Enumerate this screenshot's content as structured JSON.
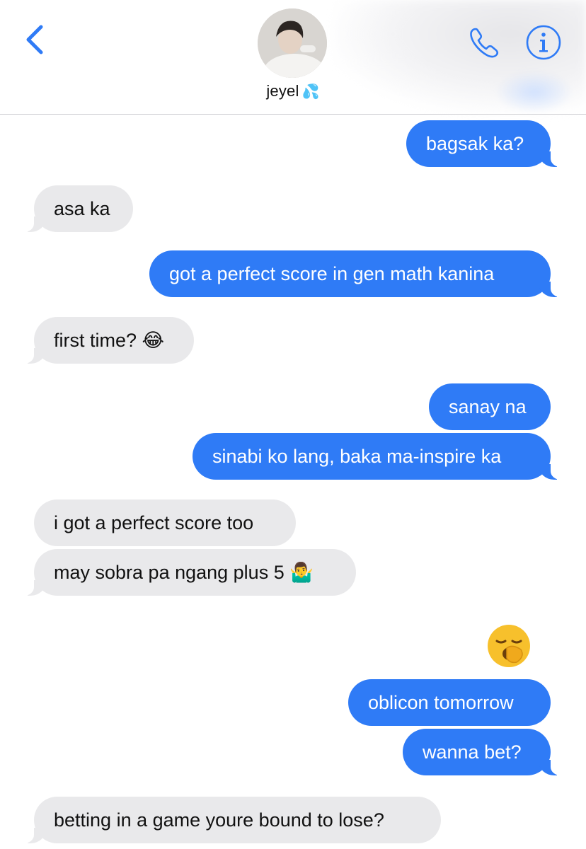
{
  "header": {
    "contact_name": "jeyel",
    "contact_emoji": "💦",
    "icons": [
      "chevron-left-icon",
      "phone-icon",
      "info-icon"
    ],
    "accent_color": "#2f7bf6"
  },
  "messages": [
    {
      "id": "m1",
      "from": "me",
      "text": "bagsak ka?"
    },
    {
      "id": "m2",
      "from": "them",
      "text": "asa ka"
    },
    {
      "id": "m3",
      "from": "me",
      "text": "got a perfect score in gen math kanina"
    },
    {
      "id": "m4",
      "from": "them",
      "text": "first time?",
      "emoji": "😂"
    },
    {
      "id": "m5",
      "from": "me",
      "text": "sanay na"
    },
    {
      "id": "m6",
      "from": "me",
      "text": "sinabi ko lang, baka ma-inspire ka"
    },
    {
      "id": "m7",
      "from": "them",
      "text": "i got a perfect score too"
    },
    {
      "id": "m8",
      "from": "them",
      "text": "may sobra pa ngang plus 5",
      "emoji": "🤷‍♂️"
    },
    {
      "id": "m9",
      "from": "me",
      "emoji": "🥱"
    },
    {
      "id": "m10",
      "from": "me",
      "text": "oblicon tomorrow"
    },
    {
      "id": "m11",
      "from": "me",
      "text": "wanna bet?"
    },
    {
      "id": "m12",
      "from": "them",
      "text": "betting in a game youre bound to lose?"
    }
  ],
  "colors": {
    "sent_bubble": "#2f7bf6",
    "received_bubble": "#e9e9eb"
  }
}
